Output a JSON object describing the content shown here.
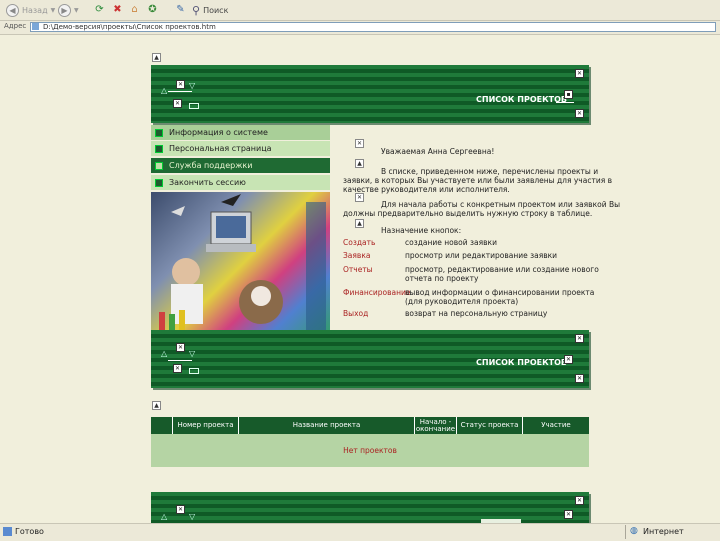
{
  "toolbar": {
    "back_label": "Назад",
    "search_label": "Поиск"
  },
  "address": {
    "label": "Адрес",
    "url": "D:\\Демо-версия\\проекты\\Список проектов.htm"
  },
  "banner": {
    "title": "СПИСОК ПРОЕКТОВ"
  },
  "menu": [
    "Информация о системе",
    "Персональная страница",
    "Служба поддержки",
    "Закончить сессию"
  ],
  "intro": {
    "greeting": "Уважаемая Анна Сергеевна!",
    "paragraph1_line1": "В списке, приведенном ниже, перечислены проекты и",
    "paragraph1_line2": "заявки, в которых Вы участвуете или были заявлены для участия в",
    "paragraph1_line3": "качестве руководителя или исполнителя.",
    "paragraph2_line1": "Для начала работы с конкретным проектом или заявкой Вы",
    "paragraph2_line2": "должны предварительно выделить нужную строку в таблице.",
    "buttons_heading": "Назначение кнопок:"
  },
  "commands": [
    {
      "name": "Создать",
      "desc1": "создание новой заявки",
      "desc2": ""
    },
    {
      "name": "Заявка",
      "desc1": "просмотр или редактирование заявки",
      "desc2": ""
    },
    {
      "name": "Отчеты",
      "desc1": "просмотр, редактирование или создание нового",
      "desc2": "отчета по проекту"
    },
    {
      "name": "Финансирование",
      "desc1": "вывод информации о финансировании проекта",
      "desc2": "(для руководителя проекта)"
    },
    {
      "name": "Выход",
      "desc1": "возврат на персональную страницу",
      "desc2": ""
    }
  ],
  "table": {
    "headers": [
      "Номер проекта",
      "Название проекта",
      "Начало - окончание",
      "Статус проекта",
      "Участие"
    ],
    "empty_text": "Нет проектов"
  },
  "status": {
    "left": "Готово",
    "right": "Интернет"
  }
}
